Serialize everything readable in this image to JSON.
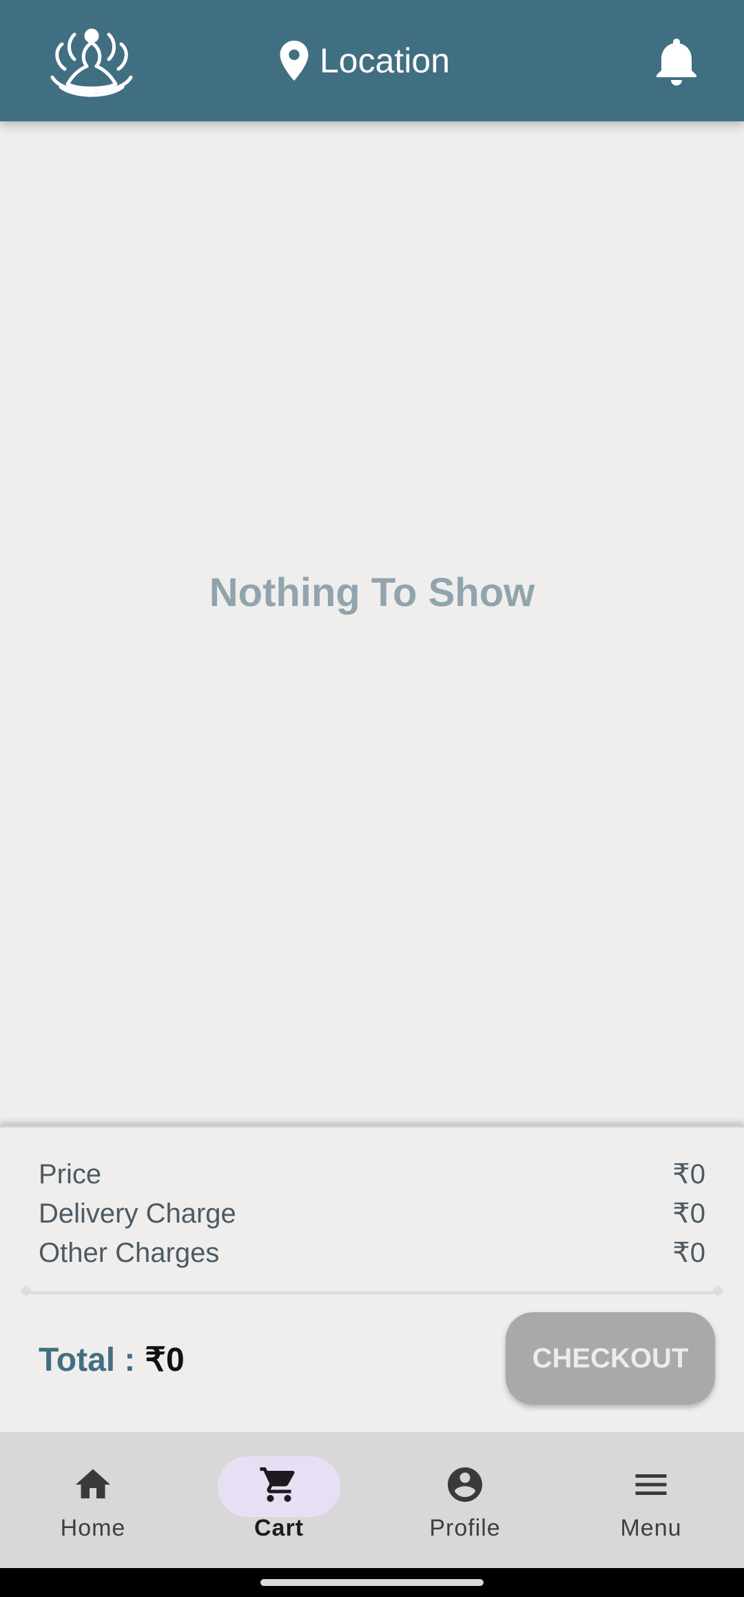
{
  "header": {
    "logo_icon": "lotus-meditation-logo",
    "location_label": "Location",
    "location_icon": "map-pin-icon",
    "bell_icon": "bell-icon"
  },
  "content": {
    "empty_message": "Nothing To Show"
  },
  "summary": {
    "rows": [
      {
        "label": "Price",
        "value": "₹0"
      },
      {
        "label": "Delivery Charge",
        "value": "₹0"
      },
      {
        "label": "Other Charges",
        "value": "₹0"
      }
    ],
    "total_label": "Total :",
    "total_value": "₹0",
    "checkout_label": "CHECKOUT"
  },
  "nav": {
    "items": [
      {
        "label": "Home",
        "icon": "home-icon"
      },
      {
        "label": "Cart",
        "icon": "cart-icon",
        "active": true
      },
      {
        "label": "Profile",
        "icon": "profile-icon"
      },
      {
        "label": "Menu",
        "icon": "menu-icon"
      }
    ]
  },
  "colors": {
    "header_bg": "#416f82",
    "accent": "#416f82",
    "checkout_disabled": "#a9a9a9",
    "active_pill": "#e9dff5"
  }
}
